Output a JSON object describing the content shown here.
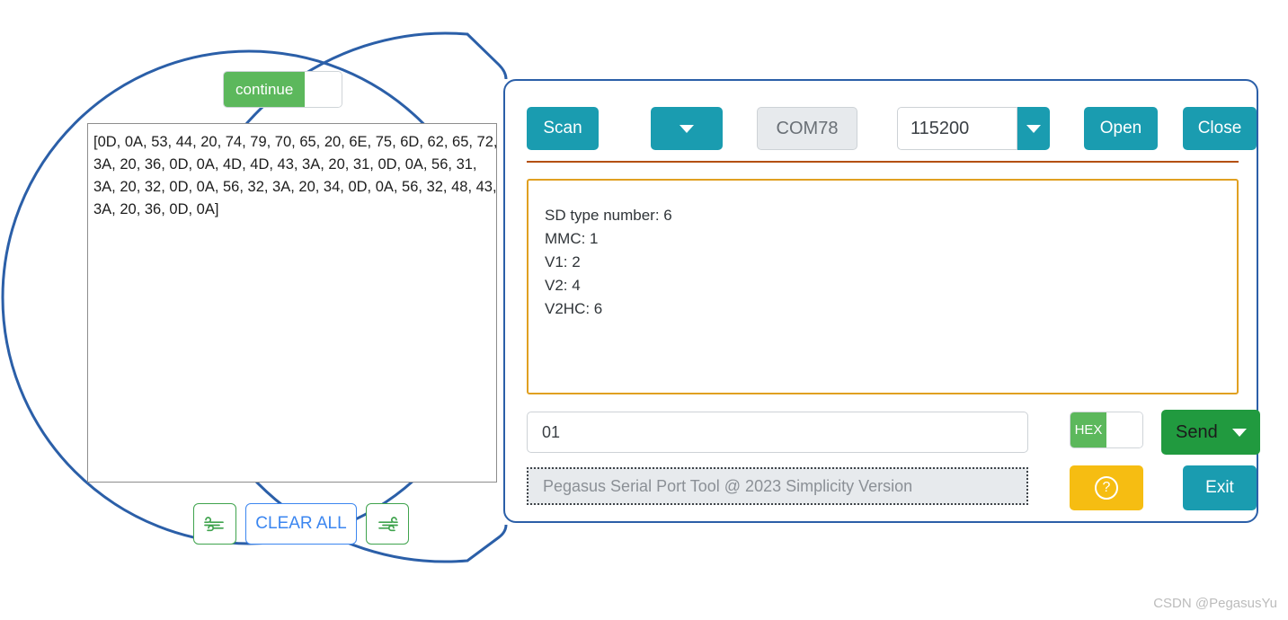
{
  "app": {
    "panel_border_color": "#2b5fa8",
    "callout_circle_color": "#2b5fa8"
  },
  "toolbar": {
    "scan_label": "Scan",
    "port_dropdown_icon": "chevron-down-icon",
    "port_value": "COM78",
    "baud_value": "115200",
    "baud_dropdown_icon": "chevron-down-icon",
    "open_label": "Open",
    "close_label": "Close",
    "accent_color": "#1a9cb0"
  },
  "console": {
    "border_color": "#e0a021",
    "lines": [
      "SD type number: 6",
      "MMC: 1",
      "V1: 2",
      "V2: 4",
      "V2HC: 6"
    ]
  },
  "send_row": {
    "input_value": "01",
    "input_placeholder": "",
    "hex_label": "HEX",
    "hex_enabled": true,
    "send_label": "Send",
    "send_dropdown_icon": "chevron-down-icon",
    "send_color": "#219a3f"
  },
  "status_row": {
    "status_text": "Pegasus Serial Port Tool @ 2023 Simplicity Version",
    "help_icon": "question-mark-icon",
    "help_color": "#f6bd12",
    "exit_label": "Exit"
  },
  "receive_panel": {
    "continue_label": "continue",
    "continue_enabled": true,
    "rx_lines": [
      "[0D, 0A, 53, 44, 20, 74, 79, 70, 65, 20, 6E, 75, 6D, 62, 65, 72,",
      "3A, 20, 36, 0D, 0A, 4D, 4D, 43, 3A, 20, 31, 0D, 0A, 56, 31,",
      "3A, 20, 32, 0D, 0A, 56, 32, 3A, 20, 34, 0D, 0A, 56, 32, 48, 43,",
      "3A, 20, 36, 0D, 0A]"
    ],
    "clear_label": "CLEAR ALL",
    "left_icon": "wind-left-icon",
    "right_icon": "wind-right-icon"
  },
  "watermark": {
    "text": "CSDN @PegasusYu"
  }
}
